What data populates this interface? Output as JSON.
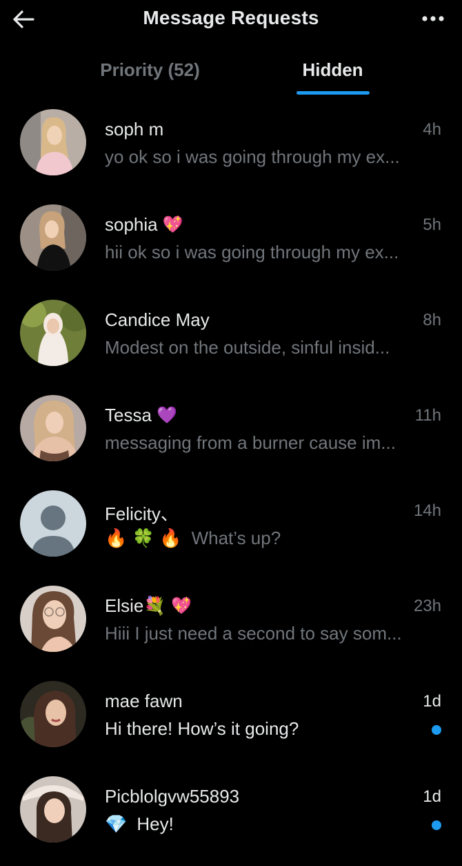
{
  "header": {
    "title": "Message Requests",
    "back_icon": "arrow-left-icon",
    "more_icon": "more-horizontal-icon"
  },
  "tabs": [
    {
      "label": "Priority (52)",
      "active": false
    },
    {
      "label": "Hidden",
      "active": true
    }
  ],
  "colors": {
    "background": "#000000",
    "accent": "#1d9bf0",
    "text_primary": "#e7e9ea",
    "text_secondary": "#71767b"
  },
  "conversations": [
    {
      "name": "soph m",
      "name_emoji": "",
      "time": "4h",
      "preview": "yo ok so i was going through my ex...",
      "preview_emojis": "",
      "unread": false
    },
    {
      "name": "sophia",
      "name_emoji": "💖",
      "time": "5h",
      "preview": "hii ok so i was going through my ex...",
      "preview_emojis": "",
      "unread": false
    },
    {
      "name": "Candice May",
      "name_emoji": "",
      "time": "8h",
      "preview": "Modest on the outside, sinful insid...",
      "preview_emojis": "",
      "unread": false
    },
    {
      "name": "Tessa",
      "name_emoji": "💜",
      "time": "11h",
      "preview": "messaging from a burner cause im...",
      "preview_emojis": "",
      "unread": false
    },
    {
      "name": "Felicity、",
      "name_emoji": "",
      "time": "14h",
      "preview": "What’s up?",
      "preview_emojis": "🔥 🍀 🔥",
      "unread": false
    },
    {
      "name": "Elsie💐",
      "name_emoji": "💖",
      "time": "23h",
      "preview": "Hiii I just need a second to say som...",
      "preview_emojis": "",
      "unread": false
    },
    {
      "name": "mae fawn",
      "name_emoji": "",
      "time": "1d",
      "preview": "Hi there! How’s it going?",
      "preview_emojis": "",
      "unread": true
    },
    {
      "name": "Picblolgvw55893",
      "name_emoji": "",
      "time": "1d",
      "preview": "Hey!",
      "preview_emojis": "💎",
      "unread": true
    }
  ]
}
